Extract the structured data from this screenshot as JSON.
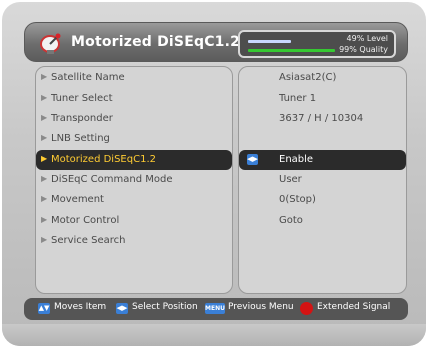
{
  "header": {
    "title": "Motorized DiSEqC1.2",
    "icon": "satellite-dish-icon",
    "signal": {
      "level_text": "49% Level",
      "quality_text": "99% Quality",
      "level_fraction": 0.49,
      "quality_fraction": 0.99
    }
  },
  "settings": [
    {
      "label": "Satellite Name",
      "value": "Asiasat2(C)"
    },
    {
      "label": "Tuner Select",
      "value": "Tuner 1"
    },
    {
      "label": "Transponder",
      "value": "3637 / H / 10304"
    },
    {
      "label": "LNB Setting",
      "value": ""
    },
    {
      "label": "Motorized DiSEqC1.2",
      "value": "Enable",
      "selected": true
    },
    {
      "label": "DiSEqC Command Mode",
      "value": "User"
    },
    {
      "label": "Movement",
      "value": "0(Stop)"
    },
    {
      "label": "Motor Control",
      "value": "Goto"
    },
    {
      "label": "Service Search",
      "value": ""
    }
  ],
  "footer": {
    "moves_item": "Moves Item",
    "select_position": "Select Position",
    "menu_key": "MENU",
    "previous_menu": "Previous Menu",
    "extended_signal": "Extended Signal"
  },
  "colors": {
    "selected_label": "#ffcc33",
    "quality_bar": "#36c832",
    "level_bar": "#c9d8ff",
    "key_blue": "#3a7fd6",
    "key_red": "#d41313"
  }
}
